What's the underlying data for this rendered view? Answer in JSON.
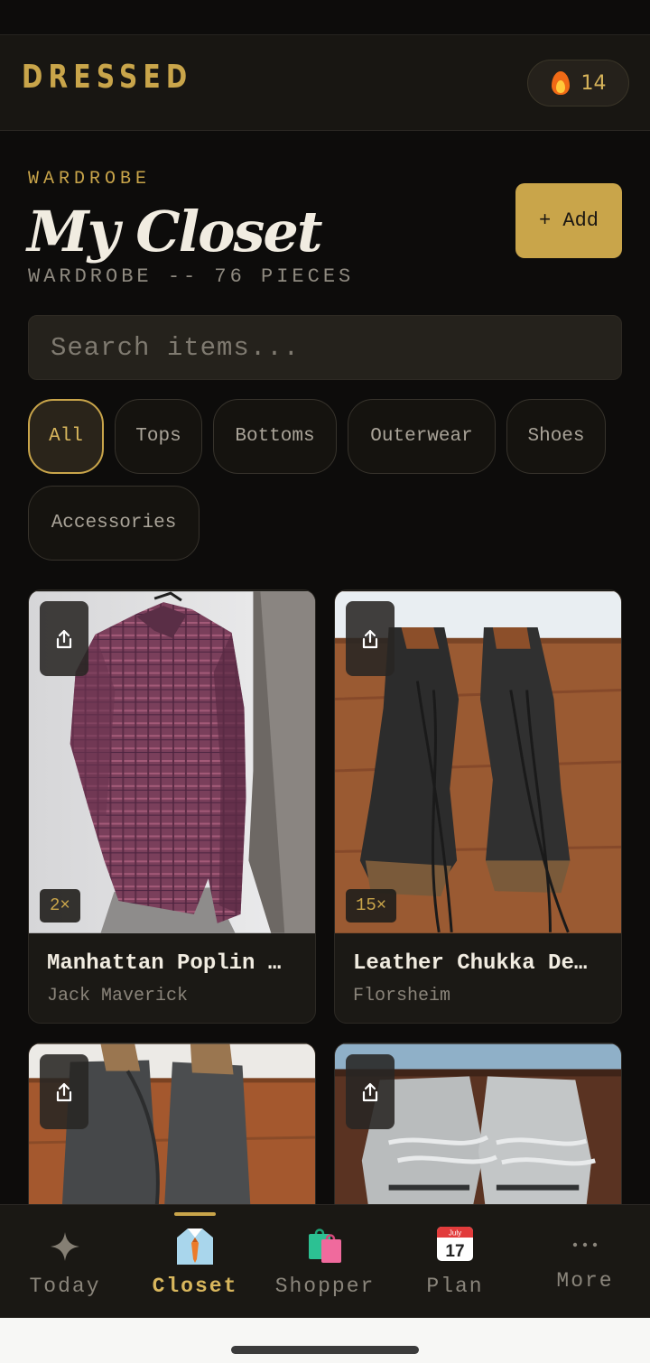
{
  "header": {
    "brand": "DRESSED",
    "streak_count": "14",
    "streak_icon": "flame-icon"
  },
  "closet": {
    "eyebrow": "WARDROBE",
    "title": "My Closet",
    "subtitle": "WARDROBE -- 76 PIECES",
    "add_label": "+ Add"
  },
  "search": {
    "placeholder": "Search items...",
    "value": ""
  },
  "filters": {
    "selected": "All",
    "chips": [
      {
        "label": "All",
        "active": true
      },
      {
        "label": "Tops",
        "active": false
      },
      {
        "label": "Bottoms",
        "active": false
      },
      {
        "label": "Outerwear",
        "active": false
      },
      {
        "label": "Shoes",
        "active": false
      },
      {
        "label": "Accessories",
        "active": false
      }
    ]
  },
  "items": [
    {
      "name": "Manhattan Poplin …",
      "brand": "Jack Maverick",
      "wear_count": "2×",
      "image": "plaid-shirt-photo"
    },
    {
      "name": "Leather Chukka De…",
      "brand": "Florsheim",
      "wear_count": "15×",
      "image": "black-chukka-boots-photo"
    },
    {
      "name": "",
      "brand": "",
      "wear_count": "",
      "image": "grey-leather-boots-photo"
    },
    {
      "name": "",
      "brand": "",
      "wear_count": "",
      "image": "grey-sneakers-photo"
    }
  ],
  "nav": {
    "active": "Closet",
    "items": [
      {
        "label": "Today",
        "icon": "sparkle-icon"
      },
      {
        "label": "Closet",
        "icon": "shirt-tie-icon"
      },
      {
        "label": "Shopper",
        "icon": "shopping-bags-icon"
      },
      {
        "label": "Plan",
        "icon": "calendar-icon",
        "icon_month": "July",
        "icon_day": "17"
      },
      {
        "label": "More",
        "icon": "more-dots-icon"
      }
    ]
  },
  "colors": {
    "accent": "#c9a54a",
    "background": "#0d0c0b",
    "surface": "#1b1915"
  }
}
